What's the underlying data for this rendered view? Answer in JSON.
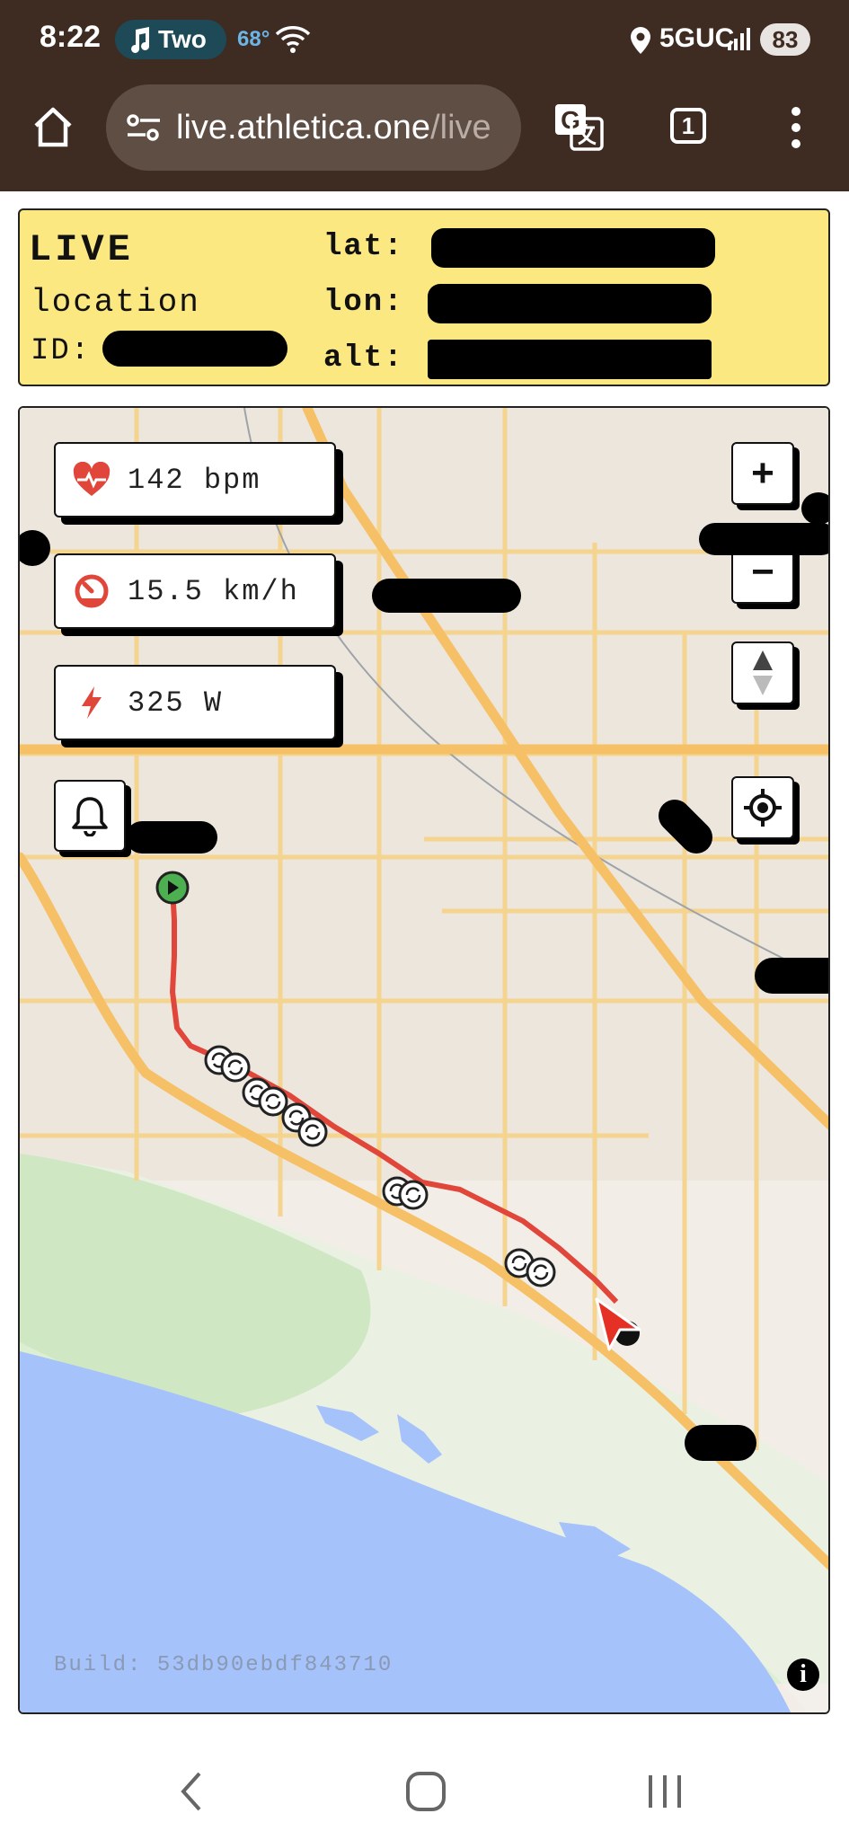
{
  "status_bar": {
    "time": "8:22",
    "media_label": "Two",
    "temperature": "68°",
    "network": "5GUC",
    "battery": "83"
  },
  "browser": {
    "url_main": "live.athletica.one",
    "url_rest": "/live",
    "tab_count": "1"
  },
  "live_panel": {
    "title": "LIVE",
    "subtitle": "location",
    "id_label": "ID:",
    "lat_label": "lat:",
    "lon_label": "lon:",
    "alt_label": "alt:"
  },
  "metrics": {
    "heart_rate": "142 bpm",
    "speed": "15.5 km/h",
    "power": "325 W"
  },
  "map": {
    "zoom_in_label": "+",
    "zoom_out_label": "−",
    "build": "Build: 53db90ebdf843710",
    "info_label": "i"
  },
  "icons": [
    "home-icon",
    "tune-icon",
    "translate-icon",
    "more-vert-icon",
    "heart-icon",
    "speedometer-icon",
    "lightning-icon",
    "bell-icon",
    "compass-icon",
    "locate-icon",
    "start-icon",
    "lap-icon",
    "position-arrow-icon",
    "info-icon",
    "back-icon",
    "home-nav-icon",
    "recents-icon"
  ],
  "colors": {
    "browser_chrome": "#3e2c22",
    "panel_yellow": "#fbe881",
    "track_red": "#e0463a",
    "ocean": "#a5c2fa",
    "road": "#f6c067"
  }
}
